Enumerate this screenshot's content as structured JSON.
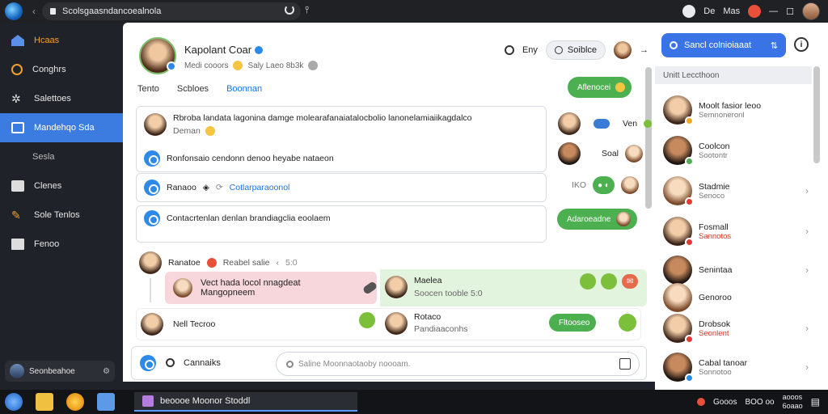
{
  "browser": {
    "url": "Scolsgaasndancoealnola",
    "right_labels": [
      "De",
      "Mas"
    ]
  },
  "sidebar": {
    "items": [
      {
        "label": "Hcaas",
        "icon": "home-icon",
        "color": "#5b8fe8"
      },
      {
        "label": "Conghrs",
        "icon": "clock-icon",
        "color": "#f0a030"
      },
      {
        "label": "Salettoes",
        "icon": "settings-icon",
        "color": "#ddd"
      },
      {
        "label": "Mandehqo Sda",
        "icon": "grid-icon",
        "color": "#fff",
        "active": true
      },
      {
        "label": "Sesla",
        "icon": "",
        "sub": true
      },
      {
        "label": "Clenes",
        "icon": "briefcase-icon",
        "color": "#ddd"
      },
      {
        "label": "Sole Tenlos",
        "icon": "tools-icon",
        "color": "#f0a030"
      },
      {
        "label": "Fenoo",
        "icon": "folder-icon",
        "color": "#ddd"
      }
    ],
    "user": "Seonbeahoe"
  },
  "main": {
    "header": {
      "name": "Kapolant Coar",
      "sub1": "Medi cooors",
      "sub2": "Saly Laeo 8b3k",
      "action_label": "Eny",
      "pill_label": "Soiblce"
    },
    "tabs": [
      "Tento",
      "Scbloes",
      "Boonnan"
    ],
    "top_button": "Aflenocei",
    "messages": {
      "m1_text": "Rbroba landata lagonina damge molearafanaiatalocbolio lanonelamiaiikagdalco",
      "m1_sub": "Deman",
      "m1_right1": "Ven",
      "m1_right2": "Soal",
      "m2_text": "Ronfonsaio cendonn denoo heyabe nataeon",
      "m3_label": "Ranaoo",
      "m3_link": "Cotlarparaoonol",
      "m3_right": "IKO",
      "m4_text": "Contacrtenlan denlan brandiagclia eoolaem",
      "m4_button": "Adaroeadne",
      "m5_label": "Ranatoe",
      "m5_text": "Reabel salie",
      "m5_time": "5:0",
      "pink_text": "Vect hada locol nnagdeat Mangopneem",
      "green_name": "Maelea",
      "green_sub": "Soocen tooble 5:0",
      "m6_label": "Nell Tecroo",
      "m6_name": "Rotaco",
      "m6_sub": "Pandiaaconhs",
      "m6_button": "Fltooseo"
    },
    "bottom": {
      "label": "Cannaiks",
      "placeholder": "Saline Moonnaotaoby noooam."
    }
  },
  "right_panel": {
    "button_label": "Sancl colnioiaaat",
    "section_title": "Unitt Leccthoon",
    "contacts": [
      {
        "name": "Moolt fasior leoo",
        "status": "Semnoneronl",
        "status_red": false,
        "badge": "#f5a623",
        "chev": false
      },
      {
        "name": "Coolcon",
        "status": "Sootontr",
        "status_red": false,
        "badge": "#4caf50",
        "chev": false
      },
      {
        "name": "Stadmie",
        "status": "Senoco",
        "status_red": false,
        "badge": "#e53935",
        "chev": true
      },
      {
        "name": "Fosmall",
        "status": "Sannotos",
        "status_red": true,
        "badge": "#e53935",
        "chev": true
      },
      {
        "name": "Senintaa",
        "status": "",
        "status_red": false,
        "badge": "",
        "chev": true
      },
      {
        "name": "Genoroo",
        "status": "",
        "status_red": false,
        "badge": "",
        "chev": false
      },
      {
        "name": "Drobsok",
        "status": "Seonlent",
        "status_red": true,
        "badge": "#e53935",
        "chev": true
      },
      {
        "name": "Cabal tanoar",
        "status": "Sonnotoo",
        "status_red": false,
        "badge": "#2d8ae8",
        "chev": true
      }
    ]
  },
  "taskbar": {
    "window_title": "beoooe Moonor Stoddl",
    "clock1": "Gooos",
    "clock2": "BOO oo",
    "clock3": "aooos",
    "clock4": "6oaao"
  }
}
